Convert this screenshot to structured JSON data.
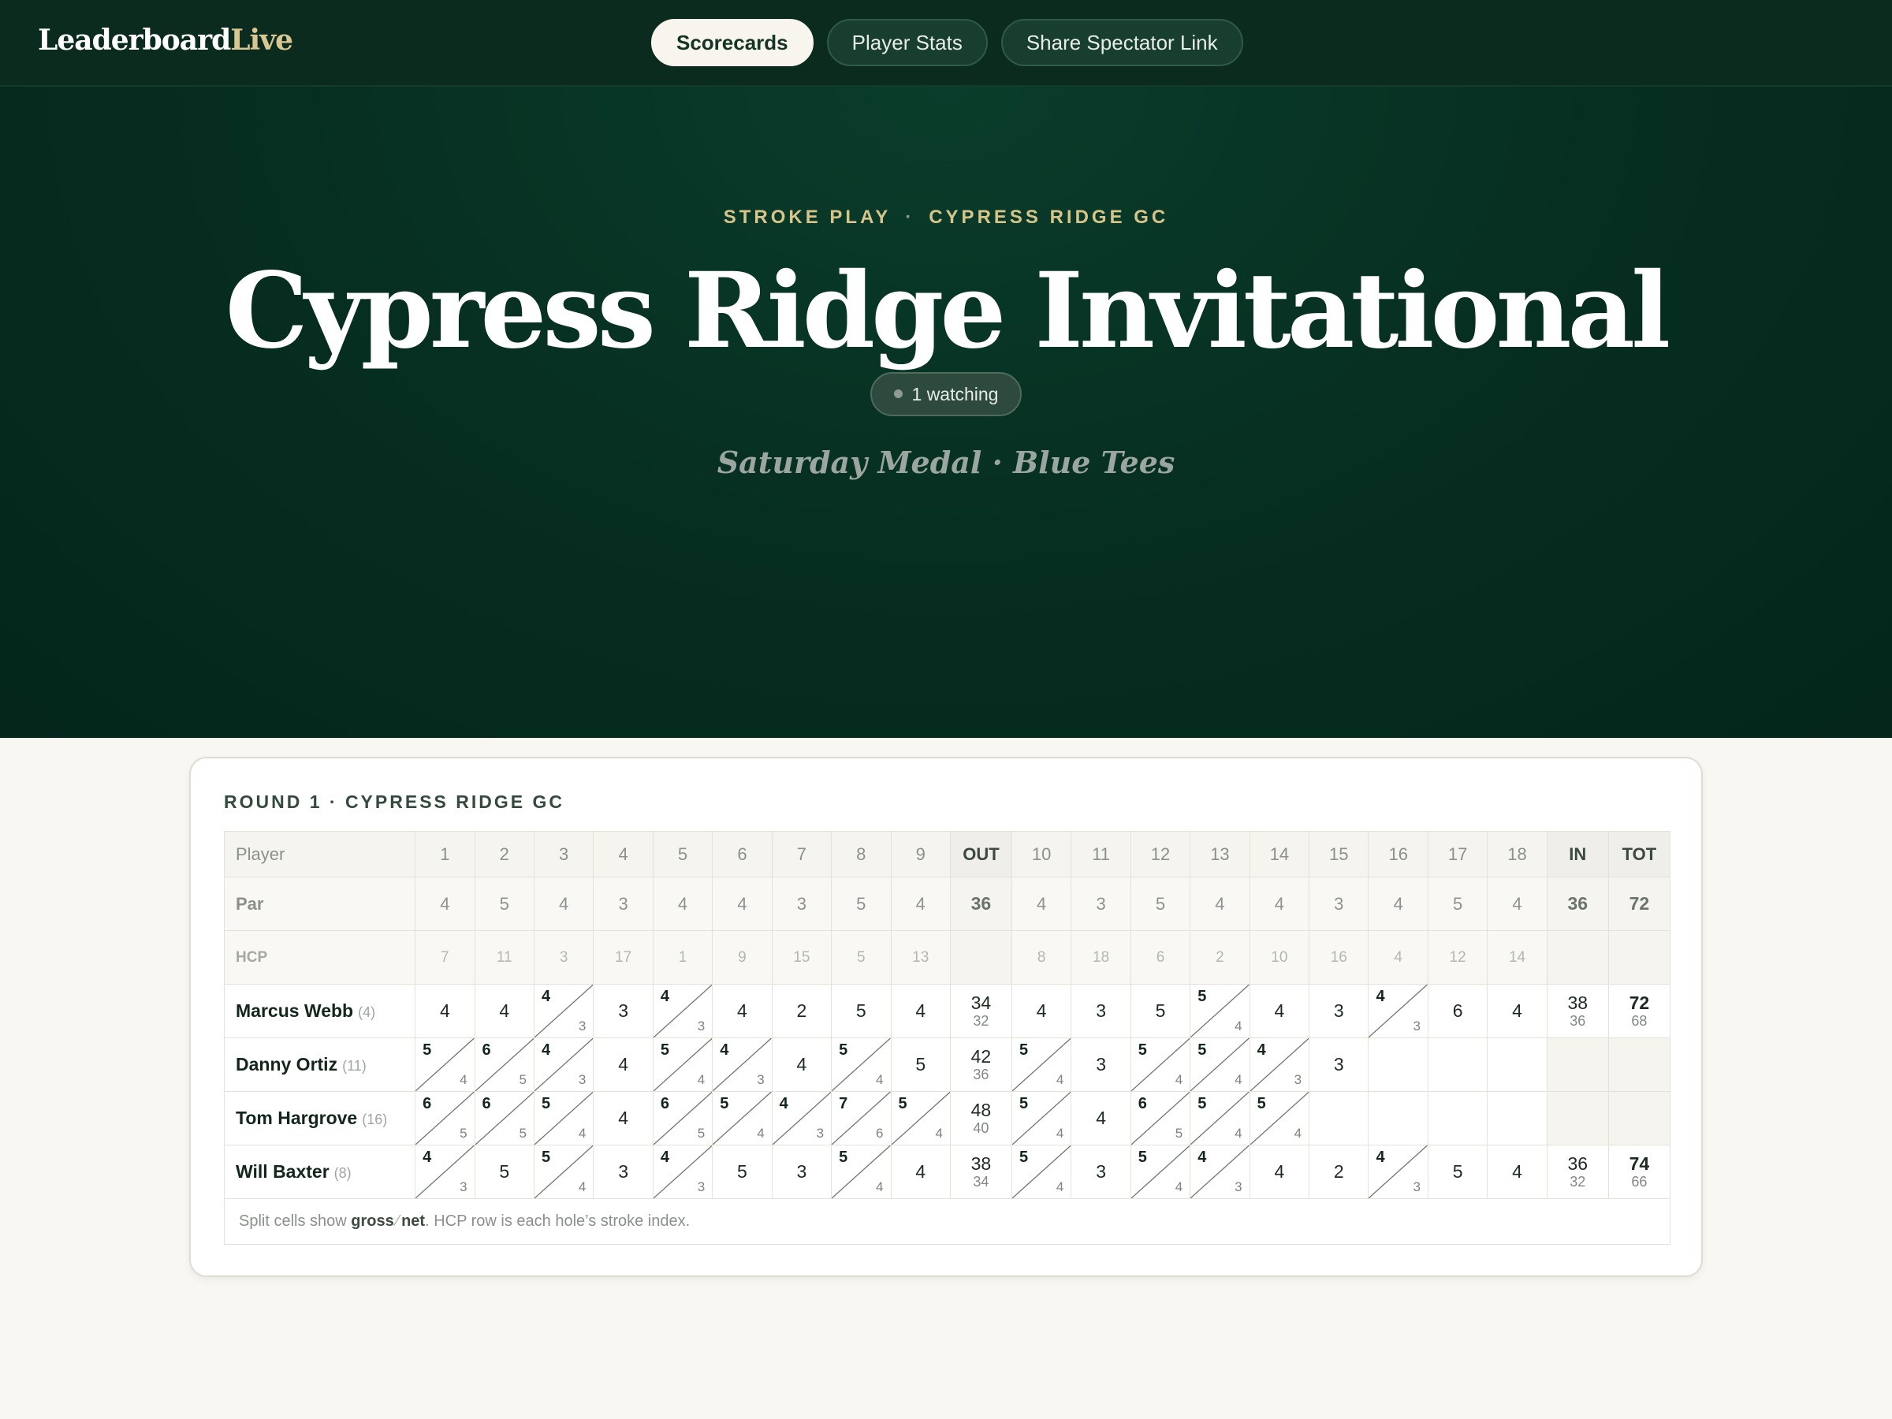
{
  "brand": {
    "main": "Leaderboard",
    "accent": "Live"
  },
  "nav": {
    "tabs": [
      "Scorecards",
      "Player Stats",
      "Share Spectator Link"
    ],
    "active": 0
  },
  "hero": {
    "eyebrow_left": "STROKE PLAY",
    "eyebrow_sep": "·",
    "eyebrow_right": "CYPRESS RIDGE GC",
    "title": "Cypress Ridge Invitational",
    "watching": "1 watching",
    "subtitle": "Saturday Medal · Blue Tees"
  },
  "scorecard": {
    "round_title": "ROUND 1 · CYPRESS RIDGE GC",
    "header_player": "Player",
    "label_out": "OUT",
    "label_in": "IN",
    "label_tot": "TOT",
    "par_label": "Par",
    "hcp_label": "HCP",
    "holes": [
      "1",
      "2",
      "3",
      "4",
      "5",
      "6",
      "7",
      "8",
      "9",
      "10",
      "11",
      "12",
      "13",
      "14",
      "15",
      "16",
      "17",
      "18"
    ],
    "par": [
      "4",
      "5",
      "4",
      "3",
      "4",
      "4",
      "3",
      "5",
      "4",
      "4",
      "3",
      "5",
      "4",
      "4",
      "3",
      "4",
      "5",
      "4"
    ],
    "par_out": "36",
    "par_in": "36",
    "par_tot": "72",
    "hcp": [
      "7",
      "11",
      "3",
      "17",
      "1",
      "9",
      "15",
      "5",
      "13",
      "8",
      "18",
      "6",
      "2",
      "10",
      "16",
      "4",
      "12",
      "14"
    ],
    "players": [
      {
        "name": "Marcus Webb",
        "hcp": "(4)",
        "scores": [
          {
            "g": "4"
          },
          {
            "g": "4"
          },
          {
            "g": "4",
            "n": "3"
          },
          {
            "g": "3"
          },
          {
            "g": "4",
            "n": "3"
          },
          {
            "g": "4"
          },
          {
            "g": "2"
          },
          {
            "g": "5"
          },
          {
            "g": "4"
          },
          {
            "g": "4"
          },
          {
            "g": "3"
          },
          {
            "g": "5"
          },
          {
            "g": "5",
            "n": "4"
          },
          {
            "g": "4"
          },
          {
            "g": "3"
          },
          {
            "g": "4",
            "n": "3"
          },
          {
            "g": "6"
          },
          {
            "g": "4"
          }
        ],
        "out": {
          "gross": "34",
          "net": "32"
        },
        "in": {
          "gross": "38",
          "net": "36"
        },
        "tot": {
          "gross": "72",
          "net": "68"
        }
      },
      {
        "name": "Danny Ortiz",
        "hcp": "(11)",
        "scores": [
          {
            "g": "5",
            "n": "4"
          },
          {
            "g": "6",
            "n": "5"
          },
          {
            "g": "4",
            "n": "3"
          },
          {
            "g": "4"
          },
          {
            "g": "5",
            "n": "4"
          },
          {
            "g": "4",
            "n": "3"
          },
          {
            "g": "4"
          },
          {
            "g": "5",
            "n": "4"
          },
          {
            "g": "5"
          },
          {
            "g": "5",
            "n": "4"
          },
          {
            "g": "3"
          },
          {
            "g": "5",
            "n": "4"
          },
          {
            "g": "5",
            "n": "4"
          },
          {
            "g": "4",
            "n": "3"
          },
          {
            "g": "3"
          },
          {},
          {},
          {}
        ],
        "out": {
          "gross": "42",
          "net": "36"
        },
        "in": {},
        "tot": {}
      },
      {
        "name": "Tom Hargrove",
        "hcp": "(16)",
        "scores": [
          {
            "g": "6",
            "n": "5"
          },
          {
            "g": "6",
            "n": "5"
          },
          {
            "g": "5",
            "n": "4"
          },
          {
            "g": "4"
          },
          {
            "g": "6",
            "n": "5"
          },
          {
            "g": "5",
            "n": "4"
          },
          {
            "g": "4",
            "n": "3"
          },
          {
            "g": "7",
            "n": "6"
          },
          {
            "g": "5",
            "n": "4"
          },
          {
            "g": "5",
            "n": "4"
          },
          {
            "g": "4"
          },
          {
            "g": "6",
            "n": "5"
          },
          {
            "g": "5",
            "n": "4"
          },
          {
            "g": "5",
            "n": "4"
          },
          {},
          {},
          {},
          {}
        ],
        "out": {
          "gross": "48",
          "net": "40"
        },
        "in": {},
        "tot": {}
      },
      {
        "name": "Will Baxter",
        "hcp": "(8)",
        "scores": [
          {
            "g": "4",
            "n": "3"
          },
          {
            "g": "5"
          },
          {
            "g": "5",
            "n": "4"
          },
          {
            "g": "3"
          },
          {
            "g": "4",
            "n": "3"
          },
          {
            "g": "5"
          },
          {
            "g": "3"
          },
          {
            "g": "5",
            "n": "4"
          },
          {
            "g": "4"
          },
          {
            "g": "5",
            "n": "4"
          },
          {
            "g": "3"
          },
          {
            "g": "5",
            "n": "4"
          },
          {
            "g": "4",
            "n": "3"
          },
          {
            "g": "4"
          },
          {
            "g": "2"
          },
          {
            "g": "4",
            "n": "3"
          },
          {
            "g": "5"
          },
          {
            "g": "4"
          }
        ],
        "out": {
          "gross": "38",
          "net": "34"
        },
        "in": {
          "gross": "36",
          "net": "32"
        },
        "tot": {
          "gross": "74",
          "net": "66"
        }
      }
    ],
    "footnote": {
      "prefix": "Split cells show ",
      "gross": "gross",
      "slash": "⁄",
      "net": "net",
      "suffix": ". HCP row is each hole’s stroke index."
    }
  }
}
